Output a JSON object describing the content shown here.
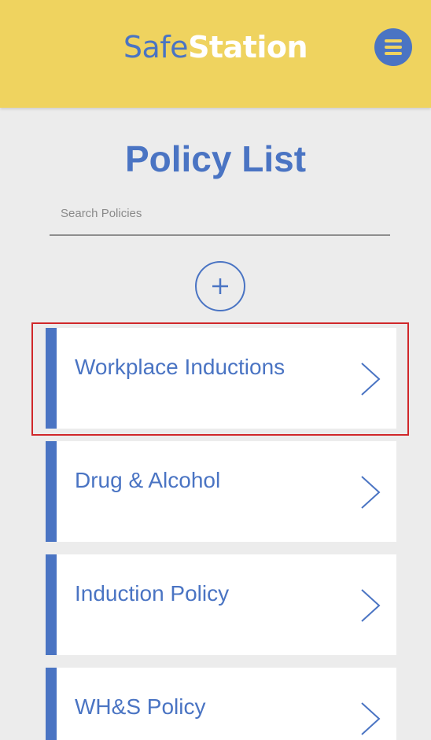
{
  "header": {
    "logo_part1": "Safe",
    "logo_part2": "Station"
  },
  "page": {
    "title": "Policy List"
  },
  "search": {
    "placeholder": "Search Policies",
    "value": ""
  },
  "policies": [
    {
      "label": "Workplace Inductions"
    },
    {
      "label": "Drug & Alcohol"
    },
    {
      "label": "Induction Policy"
    },
    {
      "label": "WH&S Policy"
    }
  ],
  "icons": {
    "menu": "hamburger-menu-icon",
    "add": "plus-icon",
    "open": "chevron-right-icon"
  },
  "colors": {
    "brand_blue": "#4a74c3",
    "header_yellow": "#efd35f",
    "background": "#ececec",
    "highlight": "#d0272a"
  }
}
